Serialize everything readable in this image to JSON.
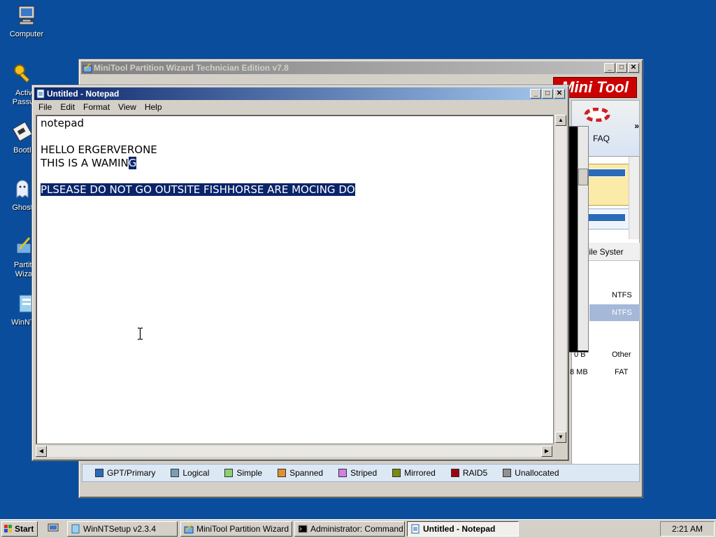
{
  "desktop": {
    "icons": [
      {
        "label": "Computer",
        "icon": "computer-icon"
      },
      {
        "label": "Activ\nPassw",
        "icon": "key-icon"
      },
      {
        "label": "BootI",
        "icon": "boot-disk-icon"
      },
      {
        "label": "Ghost",
        "icon": "ghost-icon"
      },
      {
        "label": "Partiti\nWiza",
        "icon": "partition-wizard-icon"
      },
      {
        "label": "WinNT S",
        "icon": "winnt-setup-icon"
      }
    ]
  },
  "minitool": {
    "title": "MiniTool Partition Wizard Technician Edition v7.8",
    "logo": "Mini Tool",
    "faq": "FAQ",
    "column_file_system": "File Syster",
    "rows": [
      {
        "size": "",
        "fs": "NTFS"
      },
      {
        "size": "",
        "fs": "NTFS"
      },
      {
        "size": "0 B",
        "fs": "Other"
      },
      {
        "size": "8 MB",
        "fs": "FAT"
      }
    ],
    "legend": [
      {
        "label": "GPT/Primary",
        "color": "#2a6ab8"
      },
      {
        "label": "Logical",
        "color": "#78a0b4"
      },
      {
        "label": "Simple",
        "color": "#8cd070"
      },
      {
        "label": "Spanned",
        "color": "#e09030"
      },
      {
        "label": "Striped",
        "color": "#d080e0"
      },
      {
        "label": "Mirrored",
        "color": "#788c10"
      },
      {
        "label": "RAID5",
        "color": "#a00010"
      },
      {
        "label": "Unallocated",
        "color": "#909090"
      }
    ]
  },
  "notepad": {
    "title": "Untitled - Notepad",
    "menu": [
      "File",
      "Edit",
      "Format",
      "View",
      "Help"
    ],
    "line1": "notepad",
    "line2": "HELLO ERGERVERONE",
    "line3a": "THIS IS A WAMIN",
    "line3b": "G",
    "line4": "PLSEASE DO NOT GO OUTSITE FISHHORSE ARE MOCING DO"
  },
  "taskbar": {
    "start": "Start",
    "tasks": [
      {
        "label": "WinNTSetup v2.3.4",
        "active": false
      },
      {
        "label": "MiniTool Partition Wizard ...",
        "active": false
      },
      {
        "label": "Administrator: Command...",
        "active": false
      },
      {
        "label": "Untitled - Notepad",
        "active": true
      }
    ],
    "clock": "2:21 AM"
  },
  "colors": {
    "desktop": "#0a4d9c",
    "titlebar_active": "#0a246a",
    "selection": "#0a246a",
    "logo_red": "#cc0000"
  }
}
